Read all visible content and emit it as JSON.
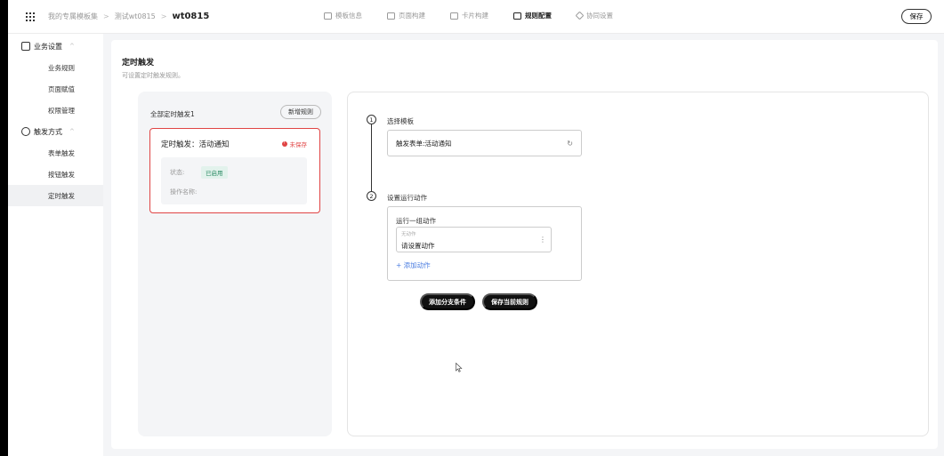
{
  "topbar": {
    "breadcrumb": [
      "我的专属模板集",
      "测试wt0815",
      "wt0815"
    ],
    "breadcrumb_sep": ">",
    "nav": [
      {
        "label": "模板信息",
        "icon": "template-icon",
        "active": false
      },
      {
        "label": "页面构建",
        "icon": "page-icon",
        "active": false
      },
      {
        "label": "卡片构建",
        "icon": "card-icon",
        "active": false
      },
      {
        "label": "规则配置",
        "icon": "rule-icon",
        "active": true
      },
      {
        "label": "协同设置",
        "icon": "collab-icon",
        "active": false
      }
    ],
    "save_label": "保存"
  },
  "sidebar": {
    "groups": [
      {
        "label": "业务设置",
        "icon": "chart-icon",
        "items": [
          "业务规则",
          "页面赋值",
          "权限管理"
        ]
      },
      {
        "label": "触发方式",
        "icon": "layers-icon",
        "items": [
          "表单触发",
          "按钮触发",
          "定时触发"
        ]
      }
    ],
    "active_item": "定时触发"
  },
  "page": {
    "title": "定时触发",
    "subtitle": "可设置定时触发规则。"
  },
  "rules_panel": {
    "header": "全部定时触发1",
    "new_button": "新增规则",
    "card": {
      "title": "定时触发：活动通知",
      "unsaved_label": "未保存",
      "status_label": "状态:",
      "status_value": "已启用",
      "action_name_label": "操作名称:"
    }
  },
  "editor": {
    "step1": {
      "num": "1",
      "label": "选择模板",
      "value": "触发表单:活动通知"
    },
    "step2": {
      "num": "2",
      "label": "设置运行动作",
      "group_title": "运行一组动作",
      "action_placeholder": "无动作",
      "action_value": "请设置动作",
      "add_action": "+ 添加动作"
    },
    "buttons": {
      "add_branch": "添加分支条件",
      "save_rule": "保存当前规则"
    }
  },
  "colors": {
    "accent_red": "#e04444",
    "status_green": "#2a8a63",
    "link_blue": "#4a7ce0"
  }
}
